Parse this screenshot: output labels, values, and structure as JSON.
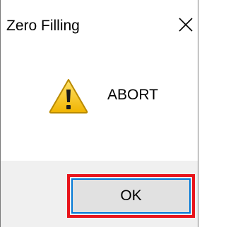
{
  "dialog": {
    "title": "Zero Filling",
    "close_icon": "close-icon",
    "message": "ABORT",
    "message_icon": "warning-icon",
    "ok_label": "OK"
  },
  "colors": {
    "highlight": "#e8141b",
    "button_focus_border": "#0078d7",
    "footer_background": "#f0f0f0",
    "warning_yellow": "#f5c400"
  }
}
